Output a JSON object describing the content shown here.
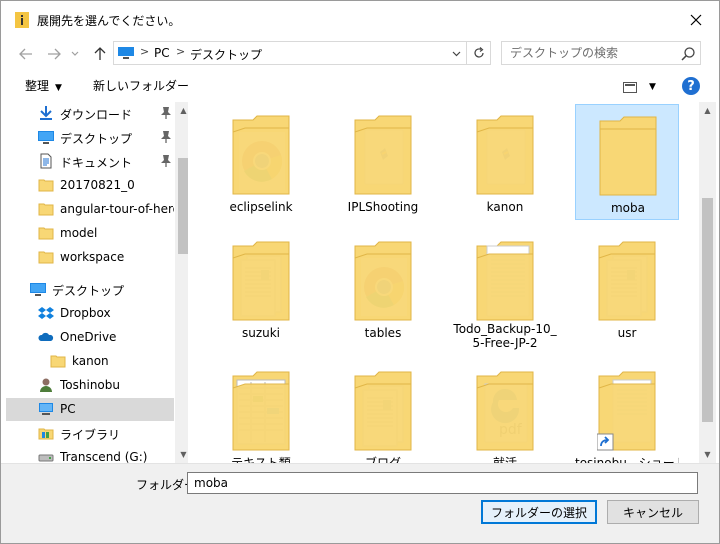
{
  "window": {
    "title": "展開先を選んでください。"
  },
  "nav": {
    "breadcrumb": [
      "PC",
      "デスクトップ"
    ],
    "search_placeholder": "デスクトップの検索"
  },
  "toolbar": {
    "organize": "整理",
    "new_folder": "新しいフォルダー"
  },
  "sidebar": {
    "items": [
      {
        "label": "ダウンロード",
        "icon": "download-icon",
        "pinned": true
      },
      {
        "label": "デスクトップ",
        "icon": "desktop-icon",
        "pinned": true
      },
      {
        "label": "ドキュメント",
        "icon": "document-icon",
        "pinned": true
      },
      {
        "label": "20170821_0",
        "icon": "folder-icon"
      },
      {
        "label": "angular-tour-of-hero",
        "icon": "folder-icon"
      },
      {
        "label": "model",
        "icon": "folder-icon"
      },
      {
        "label": "workspace",
        "icon": "folder-icon"
      },
      {
        "label": "デスクトップ",
        "icon": "desktop-icon"
      },
      {
        "label": "Dropbox",
        "icon": "dropbox-icon"
      },
      {
        "label": "OneDrive",
        "icon": "onedrive-icon"
      },
      {
        "label": "kanon",
        "icon": "folder-icon"
      },
      {
        "label": "Toshinobu",
        "icon": "user-icon"
      },
      {
        "label": "PC",
        "icon": "pc-icon",
        "selected": true
      },
      {
        "label": "ライブラリ",
        "icon": "library-icon"
      },
      {
        "label": "Transcend (G:)",
        "icon": "drive-icon"
      }
    ]
  },
  "files": [
    {
      "name": "eclipselink",
      "content": "chrome"
    },
    {
      "name": "IPLShooting",
      "content": "doc"
    },
    {
      "name": "kanon",
      "content": "doc"
    },
    {
      "name": "moba",
      "content": "empty",
      "selected": true
    },
    {
      "name": "suzuki",
      "content": "pages"
    },
    {
      "name": "tables",
      "content": "chrome"
    },
    {
      "name": "Todo_Backup-10_5-Free-JP-2",
      "content": "paper"
    },
    {
      "name": "usr",
      "content": "pages"
    },
    {
      "name": "テキスト類",
      "content": "sheet"
    },
    {
      "name": "ブログ",
      "content": "pages"
    },
    {
      "name": "就活",
      "content": "edge"
    },
    {
      "name": "tosinobu - ショート",
      "content": "shortcut"
    }
  ],
  "bottom": {
    "folder_label": "フォルダー:",
    "folder_value": "moba",
    "select_button": "フォルダーの選択",
    "cancel_button": "キャンセル"
  },
  "colors": {
    "accent": "#0078d7",
    "selection": "#cce8ff",
    "folder": "#f8d775",
    "folder_dark": "#e0b546"
  }
}
